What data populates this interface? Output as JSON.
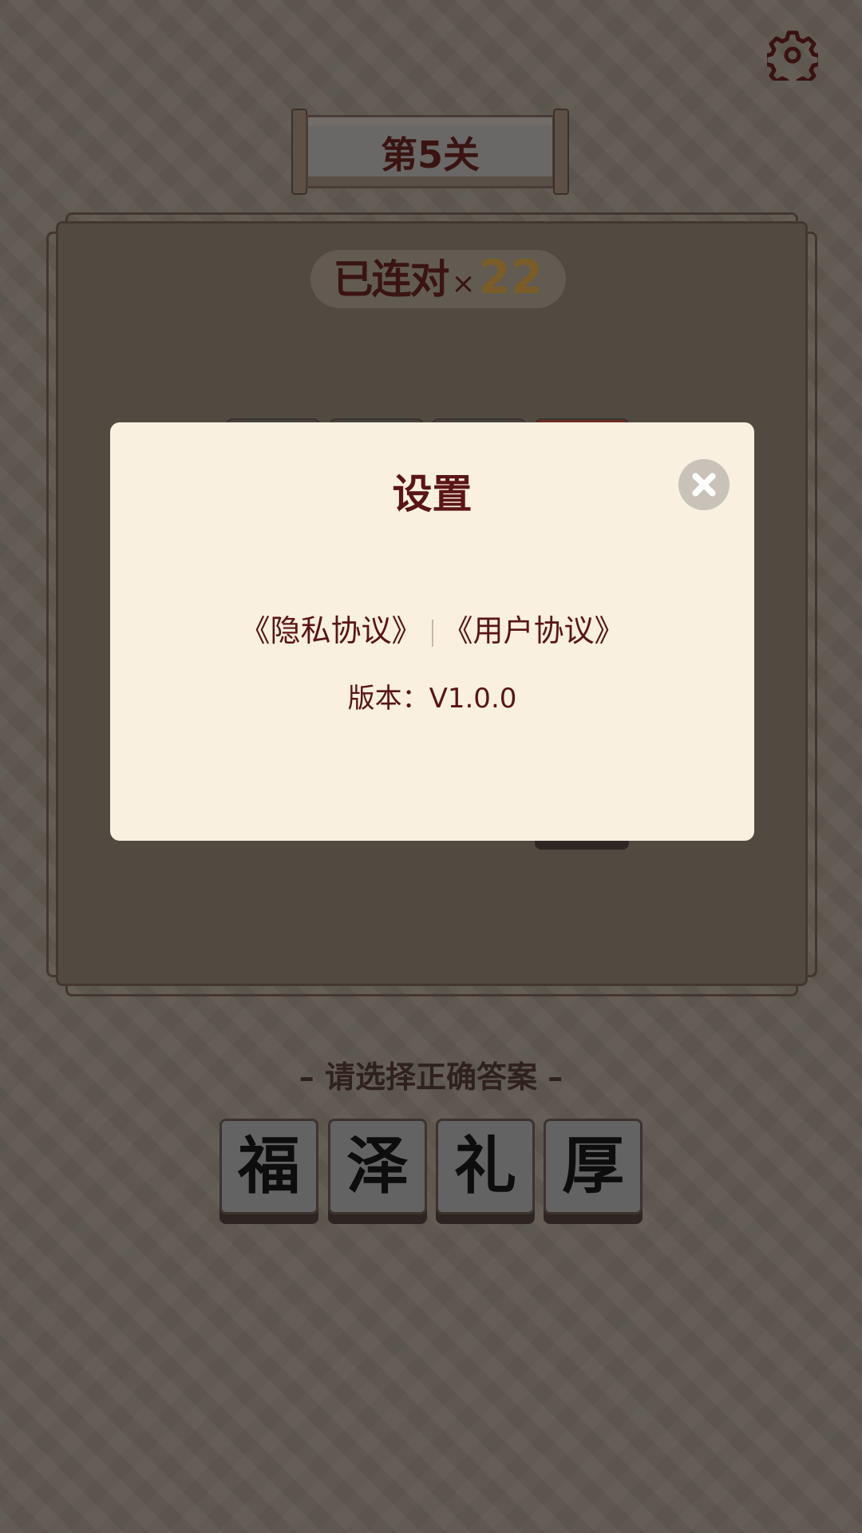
{
  "header": {
    "settings_icon": "gear-icon"
  },
  "level": {
    "title": "第5关"
  },
  "combo": {
    "label": "已连对",
    "multiplier": "×",
    "count": "22"
  },
  "dialog": {
    "title": "设置",
    "close_icon": "close-icon",
    "privacy_link": "《隐私协议》",
    "user_link": "《用户协议》",
    "version": "版本：V1.0.0"
  },
  "answer": {
    "prompt": "– 请选择正确答案 –",
    "options": [
      "福",
      "泽",
      "礼",
      "厚"
    ]
  },
  "colors": {
    "accent": "#5a1515",
    "dialog_bg": "#faf0e0",
    "background": "#5e5851",
    "board": "#514a40"
  }
}
